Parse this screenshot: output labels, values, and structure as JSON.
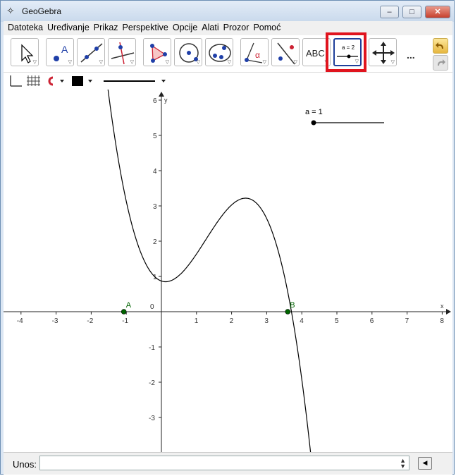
{
  "window": {
    "title": "GeoGebra",
    "app_icon": "geogebra-logo-icon",
    "controls": [
      "minimize-icon",
      "maximize-icon",
      "close-icon"
    ]
  },
  "menu": {
    "items": [
      "Datoteka",
      "Uređivanje",
      "Prikaz",
      "Perspektive",
      "Opcije",
      "Alati",
      "Prozor",
      "Pomoć"
    ]
  },
  "toolbar": {
    "tools": [
      {
        "name": "move-tool-icon"
      },
      {
        "name": "point-tool-icon",
        "label": "A"
      },
      {
        "name": "line-tool-icon"
      },
      {
        "name": "perpendicular-line-tool-icon"
      },
      {
        "name": "polygon-tool-icon"
      },
      {
        "name": "circle-tool-icon"
      },
      {
        "name": "conic-tool-icon"
      },
      {
        "name": "angle-tool-icon",
        "label": "α"
      },
      {
        "name": "reflect-tool-icon"
      },
      {
        "name": "text-tool-icon",
        "label": "ABC"
      },
      {
        "name": "slider-tool-icon",
        "label": "a = 2"
      },
      {
        "name": "move-graphics-view-tool-icon"
      }
    ],
    "more_label": "...",
    "highlighted_tool": "slider-tool-icon",
    "highlight_color": "#e0141e"
  },
  "stylebar": {
    "items": [
      "axes-toggle-icon",
      "grid-toggle-icon",
      "point-capture-icon",
      "color-swatch-icon",
      "line-style-icon"
    ]
  },
  "graphics": {
    "slider_label": "a = 1",
    "slider_value": 1,
    "x_axis_label": "x",
    "y_axis_label": "y",
    "origin_label": "0",
    "x_ticks": [
      "-4",
      "-3",
      "-2",
      "-1",
      "0",
      "1",
      "2",
      "3",
      "4",
      "5",
      "6",
      "7",
      "8"
    ],
    "y_ticks": [
      "-3",
      "-2",
      "-1",
      "1",
      "2",
      "3",
      "4",
      "5",
      "6"
    ],
    "points": [
      {
        "label": "A",
        "x": -1.07,
        "y": 0
      },
      {
        "label": "B",
        "x": 3.6,
        "y": 0
      }
    ],
    "curve": {
      "min_x": 0.12,
      "min_y": 0.85,
      "max_x": 2.4,
      "max_y": 3.22
    },
    "point_color": "#006400",
    "curve_color": "#000000"
  },
  "input_bar": {
    "label": "Unos:",
    "value": "",
    "placeholder": ""
  }
}
